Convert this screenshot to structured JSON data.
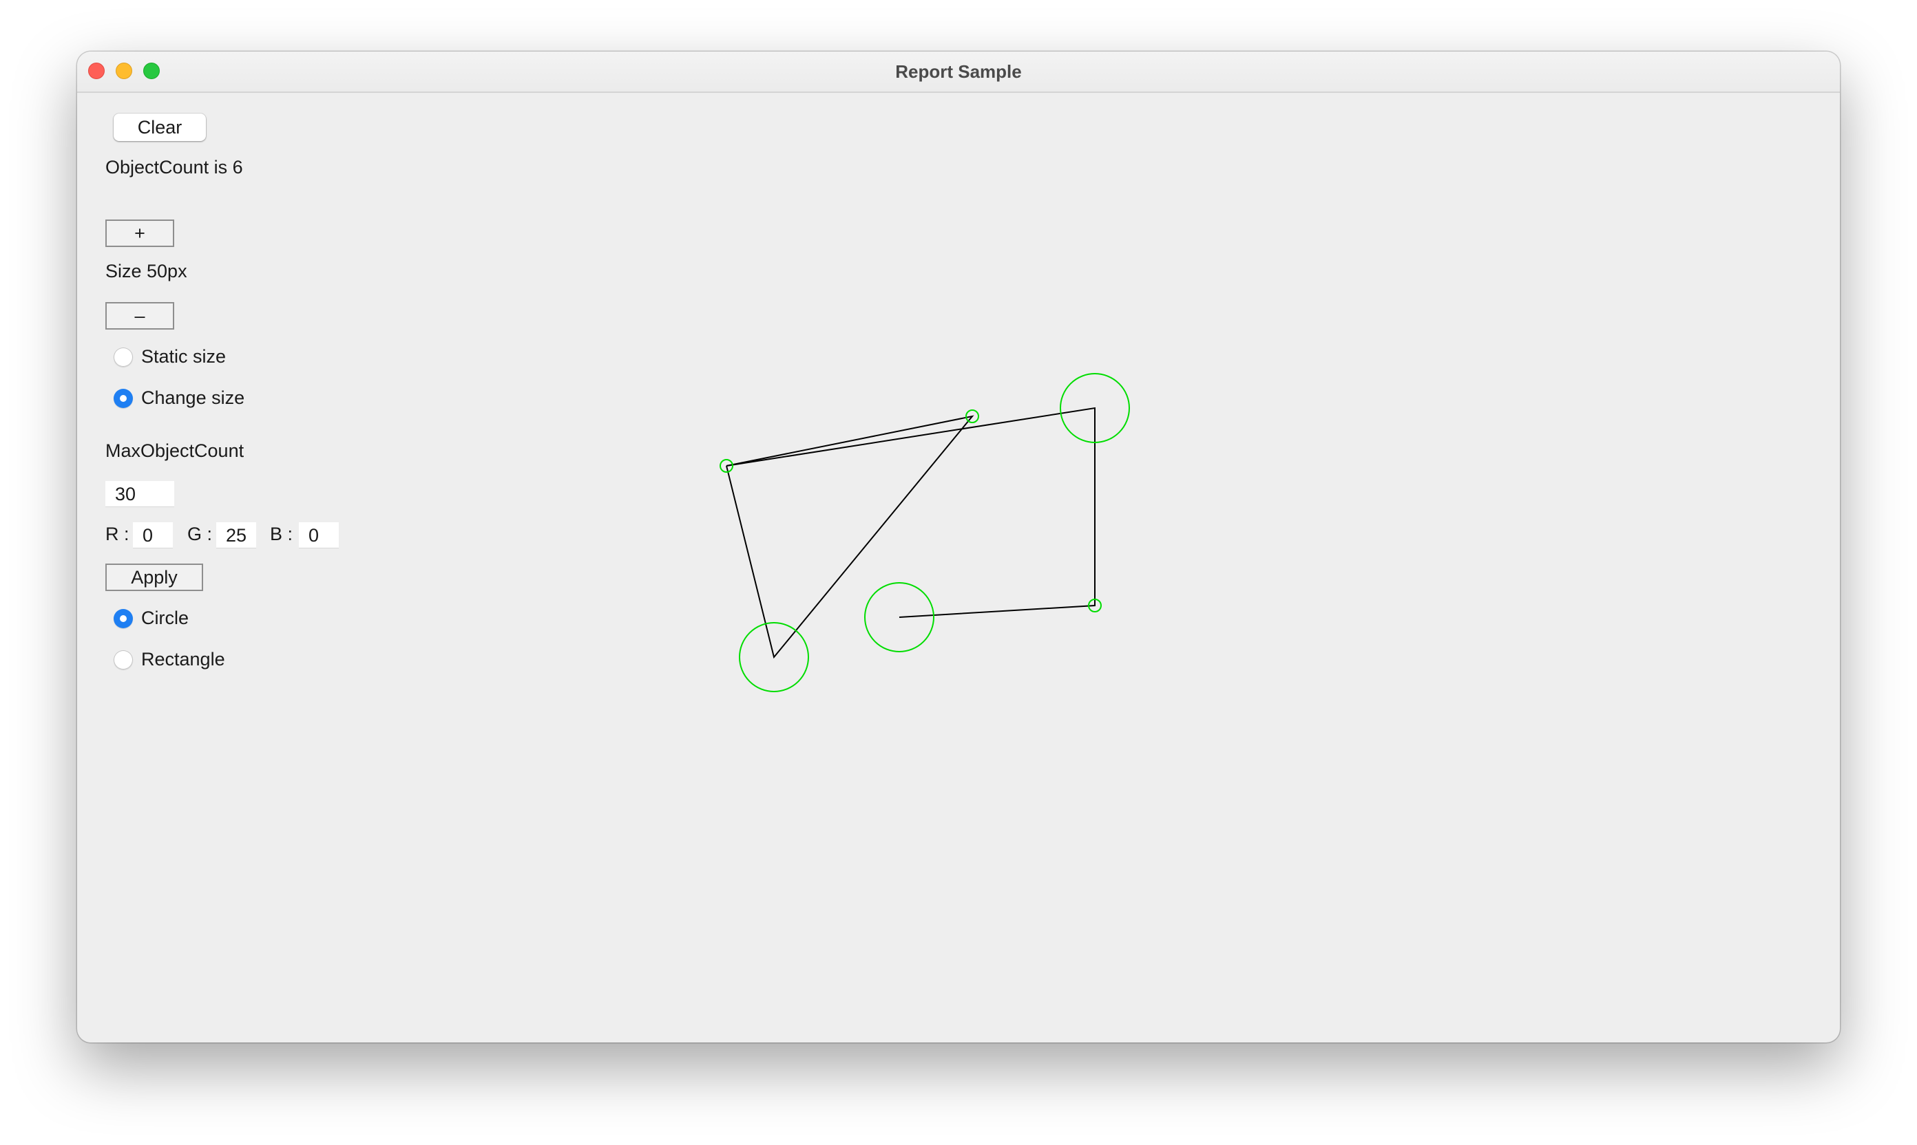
{
  "window": {
    "title": "Report Sample"
  },
  "controls": {
    "clear_label": "Clear",
    "object_count_text": "ObjectCount is 6",
    "plus_label": "+",
    "size_text": "Size 50px",
    "minus_label": "–",
    "size_mode": {
      "options": [
        "Static size",
        "Change size"
      ],
      "selected": "Change size"
    },
    "max_object_count_label": "MaxObjectCount",
    "max_object_count_value": "30",
    "color": {
      "r_label": "R :",
      "r_value": "0",
      "g_label": "G :",
      "g_value": "25",
      "b_label": "B :",
      "b_value": "0"
    },
    "apply_label": "Apply",
    "shape": {
      "options": [
        "Circle",
        "Rectangle"
      ],
      "selected": "Circle"
    }
  },
  "colors": {
    "shape_stroke": "#00dd00",
    "line_stroke": "#000000",
    "radio_selected": "#1f7ff2"
  }
}
